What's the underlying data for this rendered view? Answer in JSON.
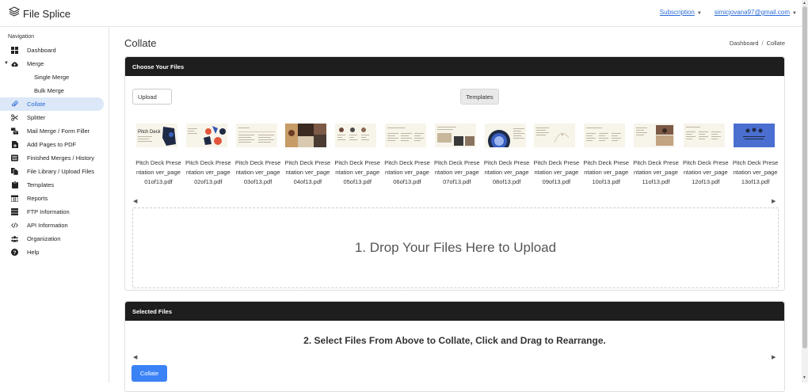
{
  "app": {
    "name": "File Splice"
  },
  "topbar": {
    "subscription": "Subscription",
    "email": "simicjovana97@gmail.com"
  },
  "sidebar": {
    "heading": "Navigation",
    "items": [
      {
        "label": "Dashboard",
        "icon": "grid-icon"
      },
      {
        "label": "Merge",
        "icon": "cloud-upload-icon",
        "expanded": true
      },
      {
        "label": "Single Merge",
        "sub": true
      },
      {
        "label": "Bulk Merge",
        "sub": true
      },
      {
        "label": "Collate",
        "icon": "paperclip-icon",
        "active": true
      },
      {
        "label": "Splitter",
        "icon": "scissors-icon"
      },
      {
        "label": "Mail Merge / Form Filler",
        "icon": "mail-bulk-icon"
      },
      {
        "label": "Add Pages to PDF",
        "icon": "file-plus-icon"
      },
      {
        "label": "Finished Merges / History",
        "icon": "inbox-icon"
      },
      {
        "label": "File Library / Upload Files",
        "icon": "file-library-icon"
      },
      {
        "label": "Templates",
        "icon": "clipboard-icon"
      },
      {
        "label": "Reports",
        "icon": "calendar-icon"
      },
      {
        "label": "FTP Information",
        "icon": "server-icon"
      },
      {
        "label": "API Information",
        "icon": "code-icon"
      },
      {
        "label": "Organization",
        "icon": "users-icon"
      },
      {
        "label": "Help",
        "icon": "question-circle-icon"
      }
    ]
  },
  "main": {
    "title": "Collate",
    "breadcrumb": [
      "Dashboard",
      "Collate"
    ],
    "choose": {
      "heading": "Choose Your Files",
      "upload_label": "Upload",
      "templates_label": "Templates",
      "files": [
        {
          "name": "Pitch Deck Presentation ver_page01of13.pdf",
          "thumb": "Pitch Deck"
        },
        {
          "name": "Pitch Deck Presentation ver_page02of13.pdf"
        },
        {
          "name": "Pitch Deck Presentation ver_page03of13.pdf"
        },
        {
          "name": "Pitch Deck Presentation ver_page04of13.pdf"
        },
        {
          "name": "Pitch Deck Presentation ver_page05of13.pdf"
        },
        {
          "name": "Pitch Deck Presentation ver_page06of13.pdf"
        },
        {
          "name": "Pitch Deck Presentation ver_page07of13.pdf"
        },
        {
          "name": "Pitch Deck Presentation ver_page08of13.pdf"
        },
        {
          "name": "Pitch Deck Presentation ver_page09of13.pdf"
        },
        {
          "name": "Pitch Deck Presentation ver_page10of13.pdf"
        },
        {
          "name": "Pitch Deck Presentation ver_page11of13.pdf"
        },
        {
          "name": "Pitch Deck Presentation ver_page12of13.pdf"
        },
        {
          "name": "Pitch Deck Presentation ver_page13of13.pdf"
        }
      ],
      "dropzone_text": "1. Drop Your Files Here to Upload"
    },
    "selected": {
      "heading": "Selected Files",
      "instructions": "2. Select Files From Above to Collate, Click and Drag to Rearrange.",
      "collate_label": "Collate"
    }
  },
  "colors": {
    "accent": "#3b82f6",
    "header_dark": "#1e1e1e",
    "active_bg": "#dce8f8",
    "link": "#2b6bd6"
  }
}
